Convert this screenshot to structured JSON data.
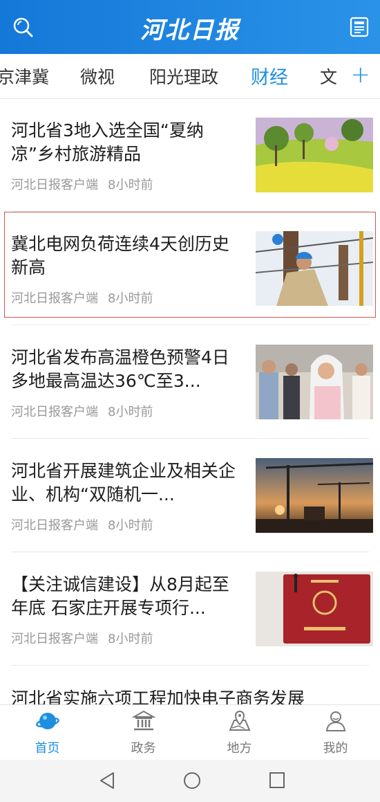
{
  "header": {
    "logo_text": "河北日报",
    "search_icon": "search-icon",
    "menu_icon": "newspaper-icon",
    "background": "#1a84de"
  },
  "tabs": [
    {
      "label": "京津冀",
      "active": false
    },
    {
      "label": "微视",
      "active": false
    },
    {
      "label": "阳光理政",
      "active": false
    },
    {
      "label": "财经",
      "active": true
    },
    {
      "label": "文",
      "active": false
    }
  ],
  "tabs_add_label": "+",
  "articles": [
    {
      "title": "河北省3地入选全国“夏纳凉”乡村旅游精品",
      "source": "河北日报客户端",
      "time": "8小时前",
      "thumb": "rural-scenery-thumbnail",
      "selected": false
    },
    {
      "title": "冀北电网负荷连续4天创历史新高",
      "source": "河北日报客户端",
      "time": "8小时前",
      "thumb": "power-workers-thumbnail",
      "selected": true
    },
    {
      "title": "河北省发布高温橙色预警4日多地最高温达36℃至3...",
      "source": "河北日报客户端",
      "time": "8小时前",
      "thumb": "street-crowd-thumbnail",
      "selected": false
    },
    {
      "title": "河北省开展建筑企业及相关企业、机构“双随机一...",
      "source": "河北日报客户端",
      "time": "8小时前",
      "thumb": "construction-cranes-thumbnail",
      "selected": false
    },
    {
      "title": "【关注诚信建设】从8月起至年底 石家庄开展专项行...",
      "source": "河北日报客户端",
      "time": "8小时前",
      "thumb": "certificate-thumbnail",
      "selected": false
    }
  ],
  "partial_article_title": "河北省实施六项工程加快电子商务发展",
  "bottom_nav": [
    {
      "label": "首页",
      "icon": "planet-icon",
      "active": true
    },
    {
      "label": "政务",
      "icon": "government-building-icon",
      "active": false
    },
    {
      "label": "地方",
      "icon": "map-pin-icon",
      "active": false
    },
    {
      "label": "我的",
      "icon": "user-icon",
      "active": false
    }
  ],
  "colors": {
    "accent": "#1e8fe0",
    "selection_border": "#d9534f"
  }
}
